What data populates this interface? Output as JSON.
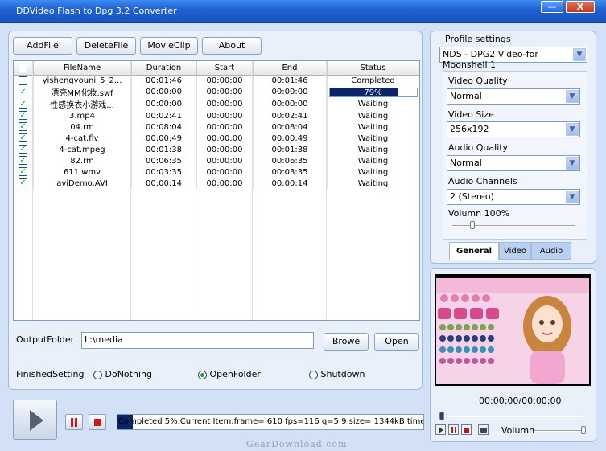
{
  "window": {
    "title": "DDVideo Flash to Dpg 3.2 Converter",
    "minimize_glyph": "—",
    "close_glyph": "X"
  },
  "toolbar": {
    "add_file": "AddFile",
    "delete_file": "DeleteFile",
    "movie_clip": "MovieClip",
    "about": "About"
  },
  "file_list": {
    "columns": [
      "FileName",
      "Duration",
      "Start",
      "End",
      "Status"
    ],
    "rows": [
      {
        "checked": false,
        "name": "yishengyouni_5_2...",
        "duration": "00:01:46",
        "start": "00:00:00",
        "end": "00:01:46",
        "status": "Completed"
      },
      {
        "checked": true,
        "name": "漂亮MM化妆.swf",
        "duration": "00:00:00",
        "start": "00:00:00",
        "end": "00:00:00",
        "status": "79%",
        "progress": 0.79
      },
      {
        "checked": true,
        "name": "性感换衣小游戏...",
        "duration": "00:00:00",
        "start": "00:00:00",
        "end": "00:00:00",
        "status": "Waiting"
      },
      {
        "checked": true,
        "name": "3.mp4",
        "duration": "00:02:41",
        "start": "00:00:00",
        "end": "00:02:41",
        "status": "Waiting"
      },
      {
        "checked": true,
        "name": "04.rm",
        "duration": "00:08:04",
        "start": "00:00:00",
        "end": "00:08:04",
        "status": "Waiting"
      },
      {
        "checked": true,
        "name": "4-cat.flv",
        "duration": "00:00:49",
        "start": "00:00:00",
        "end": "00:00:49",
        "status": "Waiting"
      },
      {
        "checked": true,
        "name": "4-cat.mpeg",
        "duration": "00:01:38",
        "start": "00:00:00",
        "end": "00:01:38",
        "status": "Waiting"
      },
      {
        "checked": true,
        "name": "82.rm",
        "duration": "00:06:35",
        "start": "00:00:00",
        "end": "00:06:35",
        "status": "Waiting"
      },
      {
        "checked": true,
        "name": "611.wmv",
        "duration": "00:03:35",
        "start": "00:00:00",
        "end": "00:03:35",
        "status": "Waiting"
      },
      {
        "checked": true,
        "name": "aviDemo.AVI",
        "duration": "00:00:14",
        "start": "00:00:00",
        "end": "00:00:14",
        "status": "Waiting"
      }
    ]
  },
  "output": {
    "label": "OutputFolder",
    "value": "L:\\media",
    "browse": "Browe",
    "open": "Open"
  },
  "finished": {
    "label": "FinishedSetting",
    "options": [
      "DoNothing",
      "OpenFolder",
      "Shutdown"
    ],
    "selected": "OpenFolder"
  },
  "status": {
    "text": "Completed 5%,Current Item:frame=  610 fps=116 q=5.9 size=     1344kB time=24",
    "progress": 0.05
  },
  "profile": {
    "label": "Profile settings",
    "selected": "NDS - DPG2 Video-for Moonshell 1",
    "video_quality_label": "Video Quality",
    "video_quality": "Normal",
    "video_size_label": "Video Size",
    "video_size": "256x192",
    "audio_quality_label": "Audio Quality",
    "audio_quality": "Normal",
    "audio_channels_label": "Audio Channels",
    "audio_channels": "2 (Stereo)",
    "volume_label": "Volumn 100%",
    "volume": 1.0,
    "tabs": [
      "General",
      "Video",
      "Audio"
    ],
    "active_tab": "General"
  },
  "preview": {
    "time": "00:00:00/00:00:00",
    "volume_label": "Volumn",
    "position": 0.0
  },
  "watermark": "GearDownload.com",
  "colors": {
    "accent": "#1a56c4",
    "progress": "#0a246a",
    "check": "#21a121",
    "stop": "#d01818"
  },
  "icons": {
    "play": "play-icon",
    "pause": "pause-icon",
    "stop": "stop-icon",
    "dropdown": "chevron-down-icon"
  }
}
